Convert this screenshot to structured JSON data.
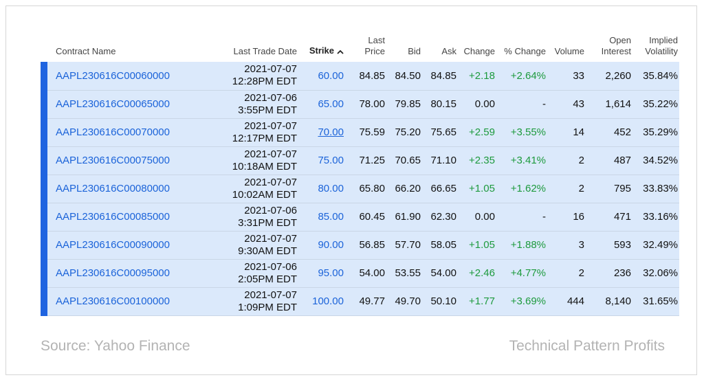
{
  "colors": {
    "row_background": "#dbe9fb",
    "row_accent_bar": "#1f64e0",
    "link_blue": "#1b63d9",
    "positive_green": "#1d9a3d",
    "footer_gray": "#b3b3b3"
  },
  "table": {
    "headers": {
      "contract_name": "Contract Name",
      "last_trade_date": "Last Trade Date",
      "strike": "Strike",
      "last_price_1": "Last",
      "last_price_2": "Price",
      "bid": "Bid",
      "ask": "Ask",
      "change": "Change",
      "pct_change": "% Change",
      "volume": "Volume",
      "open_interest_1": "Open",
      "open_interest_2": "Interest",
      "implied_volatility_1": "Implied",
      "implied_volatility_2": "Volatility"
    },
    "sort_icon": "chevron-up-icon",
    "rows": [
      {
        "contract": "AAPL230616C00060000",
        "date": "2021-07-07",
        "time": "12:28PM EDT",
        "strike": "60.00",
        "last": "84.85",
        "bid": "84.50",
        "ask": "84.85",
        "change": "+2.18",
        "pct": "+2.64%",
        "volume": "33",
        "oi": "2,260",
        "iv": "35.84%"
      },
      {
        "contract": "AAPL230616C00065000",
        "date": "2021-07-06",
        "time": "3:55PM EDT",
        "strike": "65.00",
        "last": "78.00",
        "bid": "79.85",
        "ask": "80.15",
        "change": "0.00",
        "pct": "-",
        "volume": "43",
        "oi": "1,614",
        "iv": "35.22%"
      },
      {
        "contract": "AAPL230616C00070000",
        "date": "2021-07-07",
        "time": "12:17PM EDT",
        "strike": "70.00",
        "last": "75.59",
        "bid": "75.20",
        "ask": "75.65",
        "change": "+2.59",
        "pct": "+3.55%",
        "volume": "14",
        "oi": "452",
        "iv": "35.29%"
      },
      {
        "contract": "AAPL230616C00075000",
        "date": "2021-07-07",
        "time": "10:18AM EDT",
        "strike": "75.00",
        "last": "71.25",
        "bid": "70.65",
        "ask": "71.10",
        "change": "+2.35",
        "pct": "+3.41%",
        "volume": "2",
        "oi": "487",
        "iv": "34.52%"
      },
      {
        "contract": "AAPL230616C00080000",
        "date": "2021-07-07",
        "time": "10:02AM EDT",
        "strike": "80.00",
        "last": "65.80",
        "bid": "66.20",
        "ask": "66.65",
        "change": "+1.05",
        "pct": "+1.62%",
        "volume": "2",
        "oi": "795",
        "iv": "33.83%"
      },
      {
        "contract": "AAPL230616C00085000",
        "date": "2021-07-06",
        "time": "3:31PM EDT",
        "strike": "85.00",
        "last": "60.45",
        "bid": "61.90",
        "ask": "62.30",
        "change": "0.00",
        "pct": "-",
        "volume": "16",
        "oi": "471",
        "iv": "33.16%"
      },
      {
        "contract": "AAPL230616C00090000",
        "date": "2021-07-07",
        "time": "9:30AM EDT",
        "strike": "90.00",
        "last": "56.85",
        "bid": "57.70",
        "ask": "58.05",
        "change": "+1.05",
        "pct": "+1.88%",
        "volume": "3",
        "oi": "593",
        "iv": "32.49%"
      },
      {
        "contract": "AAPL230616C00095000",
        "date": "2021-07-06",
        "time": "2:05PM EDT",
        "strike": "95.00",
        "last": "54.00",
        "bid": "53.55",
        "ask": "54.00",
        "change": "+2.46",
        "pct": "+4.77%",
        "volume": "2",
        "oi": "236",
        "iv": "32.06%"
      },
      {
        "contract": "AAPL230616C00100000",
        "date": "2021-07-07",
        "time": "1:09PM EDT",
        "strike": "100.00",
        "last": "49.77",
        "bid": "49.70",
        "ask": "50.10",
        "change": "+1.77",
        "pct": "+3.69%",
        "volume": "444",
        "oi": "8,140",
        "iv": "31.65%"
      }
    ]
  },
  "footer": {
    "source": "Source: Yahoo Finance",
    "brand": "Technical Pattern Profits"
  }
}
